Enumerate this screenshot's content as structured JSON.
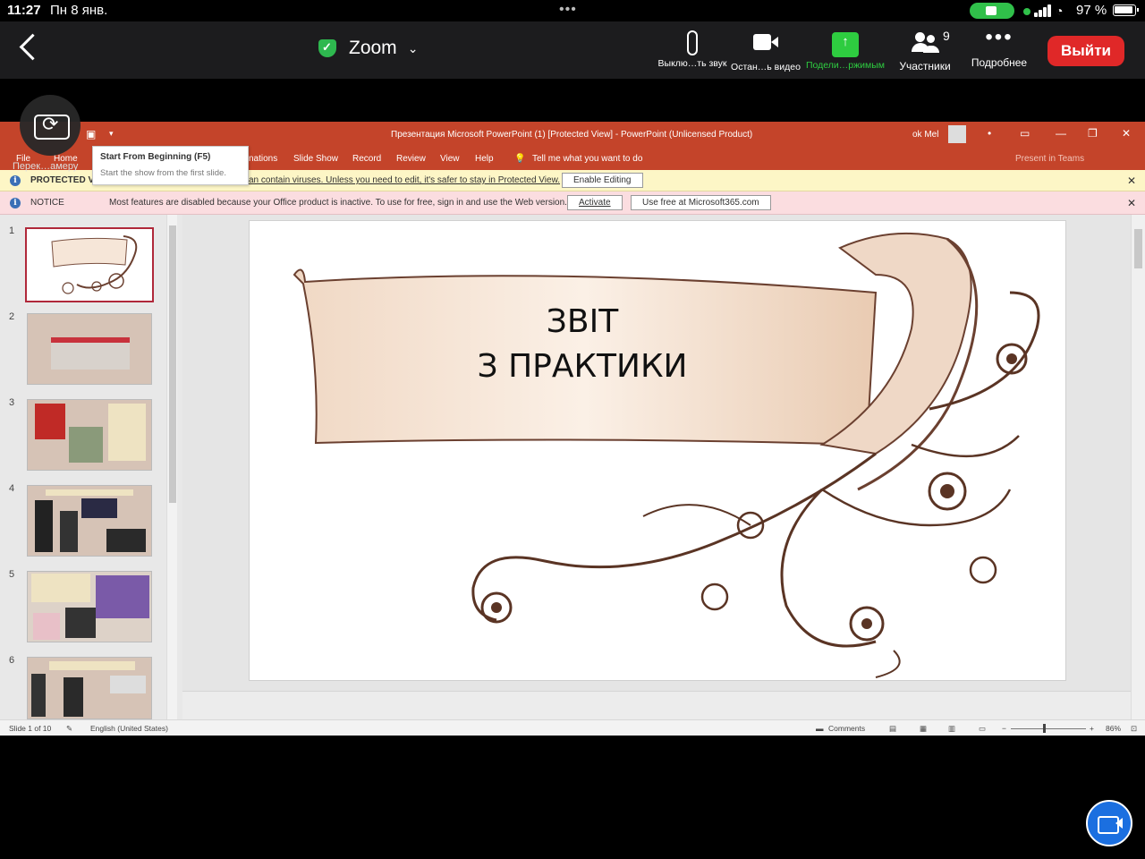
{
  "status": {
    "time": "11:27",
    "date": "Пн 8 янв.",
    "battery": "97 %"
  },
  "zoom": {
    "title": "Zoom",
    "mute_label": "Выклю…ть звук",
    "video_label": "Остан…ь видео",
    "share_label": "Подели…ржимым",
    "participants_label": "Участники",
    "participants_count": "9",
    "more_label": "Подробнее",
    "leave_label": "Выйти",
    "camera_switch_label": "Перек…амеру"
  },
  "ppt": {
    "window_title": "Презентация Microsoft PowerPoint (1) [Protected View]  -  PowerPoint (Unlicensed Product)",
    "user": "ok Mel",
    "tabs": [
      "File",
      "Home",
      "nations",
      "Slide Show",
      "Record",
      "Review",
      "View",
      "Help",
      "Tell me what you want to do"
    ],
    "teams": "Present in Teams",
    "tooltip": {
      "title": "Start From Beginning (F5)",
      "desc": "Start the show from the first slide."
    },
    "protected": {
      "label": "PROTECTED VIE",
      "text": "an contain viruses. Unless you need to edit, it's safer to stay in Protected View.",
      "button": "Enable Editing"
    },
    "notice": {
      "label": "NOTICE",
      "text": "Most features are disabled because your Office product is inactive. To use for free, sign in and use the Web version.",
      "activate": "Activate",
      "use_free": "Use free at Microsoft365.com"
    },
    "slide": {
      "line1": "ЗВІТ",
      "line2": "З ПРАКТИКИ"
    },
    "thumbs": [
      "1",
      "2",
      "3",
      "4",
      "5",
      "6"
    ],
    "statusbar": {
      "slide_of": "Slide 1 of 10",
      "language": "English (United States)",
      "comments": "Comments",
      "zoom_pct": "86%"
    }
  },
  "colors": {
    "ppt_accent": "#c4442a",
    "leave": "#e02828",
    "share": "#2ecc40"
  }
}
